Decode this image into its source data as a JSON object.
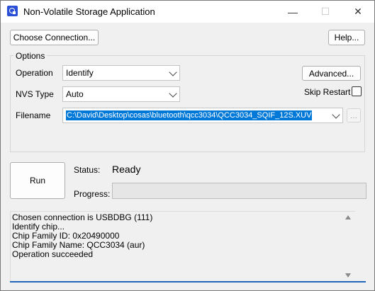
{
  "window": {
    "title": "Non-Volatile Storage Application",
    "minimize_glyph": "—",
    "maximize_glyph": "☐",
    "close_glyph": "✕"
  },
  "toolbar": {
    "choose_connection_label": "Choose Connection...",
    "help_label": "Help..."
  },
  "options": {
    "group_label": "Options",
    "operation_label": "Operation",
    "operation_value": "Identify",
    "nvs_type_label": "NVS Type",
    "nvs_type_value": "Auto",
    "advanced_label": "Advanced...",
    "skip_restart_label": "Skip Restart",
    "skip_restart_checked": false,
    "filename_label": "Filename",
    "filename_value": "C:\\David\\Desktop\\cosas\\bluetooth\\qcc3034\\QCC3034_SQIF_12S.XUV",
    "browse_label": "..."
  },
  "run": {
    "run_label": "Run",
    "status_label": "Status:",
    "status_value": "Ready",
    "progress_label": "Progress:",
    "progress_value": 0
  },
  "log": {
    "lines": [
      "Chosen connection is USBDBG (111)",
      "Identify chip...",
      "Chip Family ID: 0x20490000",
      "Chip Family Name: QCC3034 (aur)",
      "Operation succeeded"
    ]
  },
  "colors": {
    "selection": "#0078d7",
    "accent_line": "#2166b8",
    "app_icon": "#2b4fd6"
  }
}
